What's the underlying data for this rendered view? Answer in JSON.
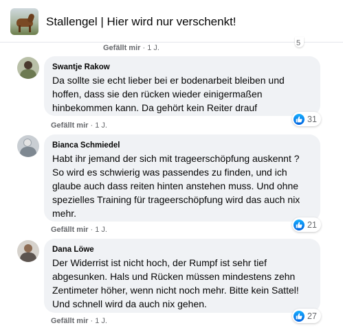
{
  "group": {
    "title": "Stallengel | Hier wird nur verschenkt!"
  },
  "top_partial": {
    "like_label": "Gefällt mir",
    "separator": " · ",
    "time": "1 J.",
    "reaction_count": "5"
  },
  "comments": [
    {
      "author": "Swantje Rakow",
      "text": "Da sollte sie echt lieber bei er bodenarbeit bleiben und hoffen, dass sie den rücken wieder einigermaßen hinbekommen kann. Da gehört kein Reiter drauf",
      "like_label": "Gefällt mir",
      "separator": " · ",
      "time": "1 J.",
      "reaction_count": "31"
    },
    {
      "author": "Bianca Schmiedel",
      "text": "Habt ihr jemand der sich mit trageerschöpfung auskennt ? So wird es schwierig was passendes zu finden, und ich glaube auch dass reiten hinten anstehen muss. Und ohne spezielles Training für trageerschöpfung wird das auch nix mehr.",
      "like_label": "Gefällt mir",
      "separator": " · ",
      "time": "1 J.",
      "reaction_count": "21"
    },
    {
      "author": "Dana Löwe",
      "text": "Der Widerrist ist nicht hoch, der Rumpf ist sehr tief abgesunken. Hals und Rücken müssen mindestens zehn Zentimeter höher, wenn nicht noch mehr. Bitte kein Sattel! Und schnell wird da auch nix gehen.",
      "like_label": "Gefällt mir",
      "separator": " · ",
      "time": "1 J.",
      "reaction_count": "27"
    }
  ],
  "icons": {
    "reaction": "like-thumb-icon"
  },
  "colors": {
    "like_blue": "#1877f2",
    "bubble": "#f0f2f5",
    "meta_grey": "#65676b"
  }
}
